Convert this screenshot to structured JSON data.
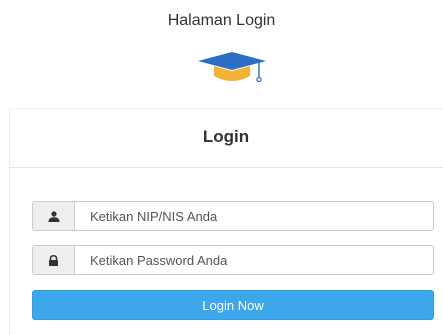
{
  "header": {
    "title": "Halaman Login",
    "logo_icon": "graduation-cap-icon"
  },
  "card": {
    "heading": "Login"
  },
  "form": {
    "username": {
      "icon": "user-icon",
      "placeholder": "Ketikan NIP/NIS Anda",
      "value": ""
    },
    "password": {
      "icon": "lock-icon",
      "placeholder": "Ketikan Password Anda",
      "value": ""
    },
    "submit_label": "Login Now"
  },
  "colors": {
    "primary": "#3da7ec",
    "cap_blue": "#2a6fc4",
    "cap_orange": "#f2b233",
    "addon_bg": "#eeeeee",
    "border": "#cccccc"
  }
}
